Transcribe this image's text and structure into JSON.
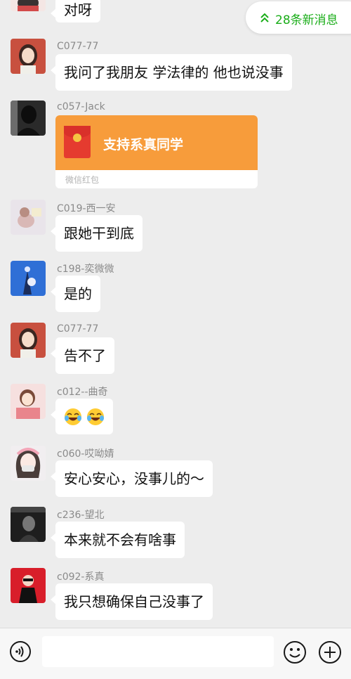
{
  "new_messages_label": "28条新消息",
  "input_placeholder": "",
  "messages": [
    {
      "text": "对呀"
    },
    {
      "nickname": "C077-77",
      "text": "我问了我朋友 学法律的 他也说没事"
    },
    {
      "nickname": "c057-Jack",
      "red_packet": {
        "title": "支持系真同学",
        "footer": "微信红包"
      }
    },
    {
      "nickname": "C019-西一安",
      "text": "跟她干到底"
    },
    {
      "nickname": "c198-奕微微",
      "text": "是的"
    },
    {
      "nickname": "C077-77",
      "text": "告不了"
    },
    {
      "nickname": "c012--曲奇",
      "emojis": [
        "face-with-tears-of-joy-icon",
        "face-with-tears-of-joy-icon"
      ]
    },
    {
      "nickname": "c060-哎呦婧",
      "text": "安心安心，没事儿的～"
    },
    {
      "nickname": "c236-望北",
      "text": "本来就不会有啥事"
    },
    {
      "nickname": "c092-系真",
      "text": "我只想确保自己没事了"
    }
  ],
  "colors": {
    "accent_green": "#1aad19",
    "red_packet_orange": "#f79c3b",
    "chat_background": "#ededed"
  }
}
